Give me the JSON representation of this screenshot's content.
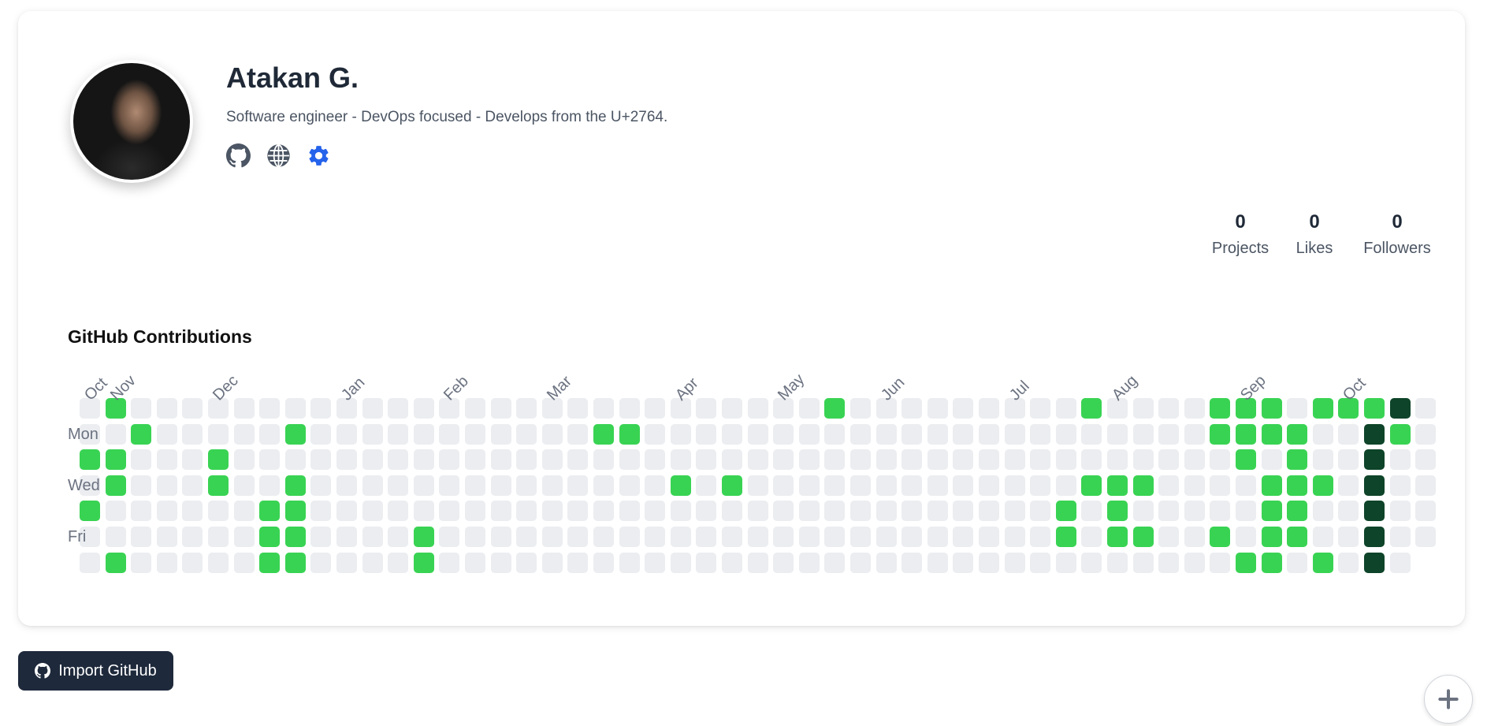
{
  "profile": {
    "name": "Atakan G.",
    "bio": "Software engineer - DevOps focused - Develops from the U+2764."
  },
  "stats": {
    "projects_value": "0",
    "projects_label": "Projects",
    "likes_value": "0",
    "likes_label": "Likes",
    "followers_value": "0",
    "followers_label": "Followers"
  },
  "contributions": {
    "title": "GitHub Contributions",
    "months": [
      {
        "label": "Oct",
        "week": 0
      },
      {
        "label": "Nov",
        "week": 1
      },
      {
        "label": "Dec",
        "week": 5
      },
      {
        "label": "Jan",
        "week": 10
      },
      {
        "label": "Feb",
        "week": 14
      },
      {
        "label": "Mar",
        "week": 18
      },
      {
        "label": "Apr",
        "week": 23
      },
      {
        "label": "May",
        "week": 27
      },
      {
        "label": "Jun",
        "week": 31
      },
      {
        "label": "Jul",
        "week": 36
      },
      {
        "label": "Aug",
        "week": 40
      },
      {
        "label": "Sep",
        "week": 45
      },
      {
        "label": "Oct",
        "week": 49
      }
    ],
    "day_labels": [
      {
        "label": "Mon",
        "row": 1
      },
      {
        "label": "Wed",
        "row": 3
      },
      {
        "label": "Fri",
        "row": 5
      }
    ],
    "weeks": 53,
    "active": [
      [
        1,
        0,
        1
      ],
      [
        2,
        1,
        1
      ],
      [
        0,
        2,
        1
      ],
      [
        1,
        2,
        1
      ],
      [
        1,
        3,
        1
      ],
      [
        0,
        4,
        1
      ],
      [
        1,
        6,
        1
      ],
      [
        5,
        2,
        1
      ],
      [
        5,
        3,
        1
      ],
      [
        7,
        4,
        1
      ],
      [
        7,
        5,
        1
      ],
      [
        7,
        6,
        1
      ],
      [
        8,
        1,
        1
      ],
      [
        8,
        3,
        1
      ],
      [
        8,
        4,
        1
      ],
      [
        8,
        5,
        1
      ],
      [
        8,
        6,
        1
      ],
      [
        13,
        5,
        1
      ],
      [
        13,
        6,
        1
      ],
      [
        20,
        1,
        1
      ],
      [
        21,
        1,
        1
      ],
      [
        23,
        3,
        1
      ],
      [
        25,
        3,
        1
      ],
      [
        29,
        0,
        1
      ],
      [
        38,
        4,
        1
      ],
      [
        38,
        5,
        1
      ],
      [
        39,
        0,
        1
      ],
      [
        39,
        3,
        1
      ],
      [
        40,
        3,
        1
      ],
      [
        40,
        4,
        1
      ],
      [
        40,
        5,
        1
      ],
      [
        41,
        3,
        1
      ],
      [
        41,
        5,
        1
      ],
      [
        44,
        0,
        1
      ],
      [
        44,
        1,
        1
      ],
      [
        44,
        5,
        1
      ],
      [
        45,
        0,
        1
      ],
      [
        45,
        1,
        1
      ],
      [
        45,
        2,
        1
      ],
      [
        45,
        6,
        1
      ],
      [
        46,
        0,
        1
      ],
      [
        46,
        1,
        1
      ],
      [
        46,
        3,
        1
      ],
      [
        46,
        4,
        1
      ],
      [
        46,
        5,
        1
      ],
      [
        46,
        6,
        1
      ],
      [
        47,
        1,
        1
      ],
      [
        47,
        2,
        1
      ],
      [
        47,
        3,
        1
      ],
      [
        47,
        4,
        1
      ],
      [
        47,
        5,
        1
      ],
      [
        48,
        0,
        1
      ],
      [
        48,
        3,
        1
      ],
      [
        48,
        6,
        1
      ],
      [
        49,
        0,
        1
      ],
      [
        50,
        0,
        1
      ],
      [
        50,
        1,
        2
      ],
      [
        50,
        2,
        2
      ],
      [
        50,
        3,
        2
      ],
      [
        50,
        4,
        2
      ],
      [
        50,
        5,
        2
      ],
      [
        50,
        6,
        2
      ],
      [
        51,
        0,
        2
      ],
      [
        51,
        1,
        1
      ]
    ],
    "last_week_days": 6,
    "colors": {
      "empty": "#ebedf0",
      "level1": "#39d353",
      "level2": "#0e4429"
    }
  },
  "actions": {
    "import_github_label": "Import GitHub"
  },
  "icons": [
    "github-icon",
    "globe-icon",
    "gear-icon",
    "plus-icon"
  ],
  "colors": {
    "accent": "#2563eb",
    "button_bg": "#1e293b"
  }
}
